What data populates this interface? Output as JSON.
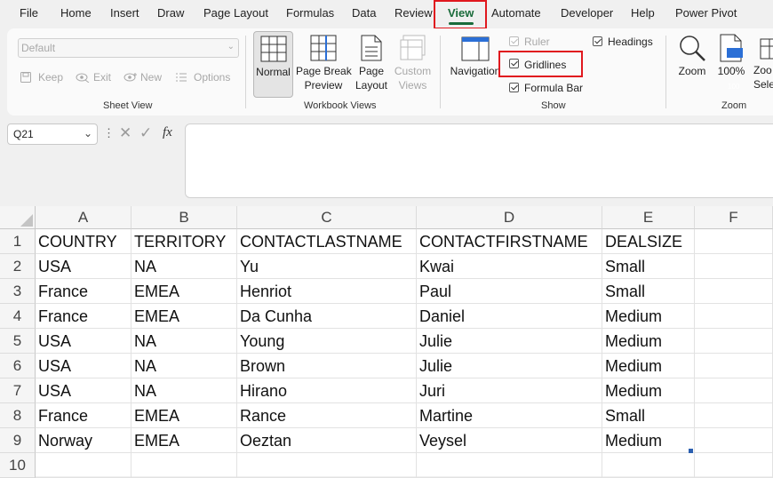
{
  "menu": {
    "items": [
      "File",
      "Home",
      "Insert",
      "Draw",
      "Page Layout",
      "Formulas",
      "Data",
      "Review",
      "View",
      "Automate",
      "Developer",
      "Help",
      "Power Pivot"
    ],
    "active": "View"
  },
  "ribbon": {
    "sheet_view": {
      "dropdown_value": "Default",
      "keep": "Keep",
      "exit": "Exit",
      "new": "New",
      "options": "Options",
      "label": "Sheet View"
    },
    "workbook_views": {
      "normal": "Normal",
      "page_break_1": "Page Break",
      "page_break_2": "Preview",
      "page_layout_1": "Page",
      "page_layout_2": "Layout",
      "custom_1": "Custom",
      "custom_2": "Views",
      "label": "Workbook Views"
    },
    "show": {
      "navigation": "Navigation",
      "ruler": "Ruler",
      "gridlines": "Gridlines",
      "formula_bar": "Formula Bar",
      "headings": "Headings",
      "label": "Show"
    },
    "zoom": {
      "zoom": "Zoom",
      "hundred": "100%",
      "zoom_sel_1": "Zoo",
      "zoom_sel_2": "Sele",
      "label": "Zoom",
      "icon_badge": "100"
    }
  },
  "formula_bar": {
    "name_box": "Q21",
    "fx": "fx",
    "content": ""
  },
  "sheet": {
    "columns": [
      "A",
      "B",
      "C",
      "D",
      "E",
      "F"
    ],
    "rows": [
      "1",
      "2",
      "3",
      "4",
      "5",
      "6",
      "7",
      "8",
      "9",
      "10"
    ],
    "data": [
      [
        "COUNTRY",
        "TERRITORY",
        "CONTACTLASTNAME",
        "CONTACTFIRSTNAME",
        "DEALSIZE"
      ],
      [
        "USA",
        "NA",
        "Yu",
        "Kwai",
        "Small"
      ],
      [
        "France",
        "EMEA",
        "Henriot",
        "Paul",
        "Small"
      ],
      [
        "France",
        "EMEA",
        "Da Cunha",
        "Daniel",
        "Medium"
      ],
      [
        "USA",
        "NA",
        "Young",
        "Julie",
        "Medium"
      ],
      [
        "USA",
        "NA",
        "Brown",
        "Julie",
        "Medium"
      ],
      [
        "USA",
        "NA",
        "Hirano",
        "Juri",
        "Medium"
      ],
      [
        "France",
        "EMEA",
        "Rance",
        "Martine",
        "Small"
      ],
      [
        "Norway",
        "EMEA",
        "Oeztan",
        "Veysel",
        "Medium"
      ]
    ]
  }
}
